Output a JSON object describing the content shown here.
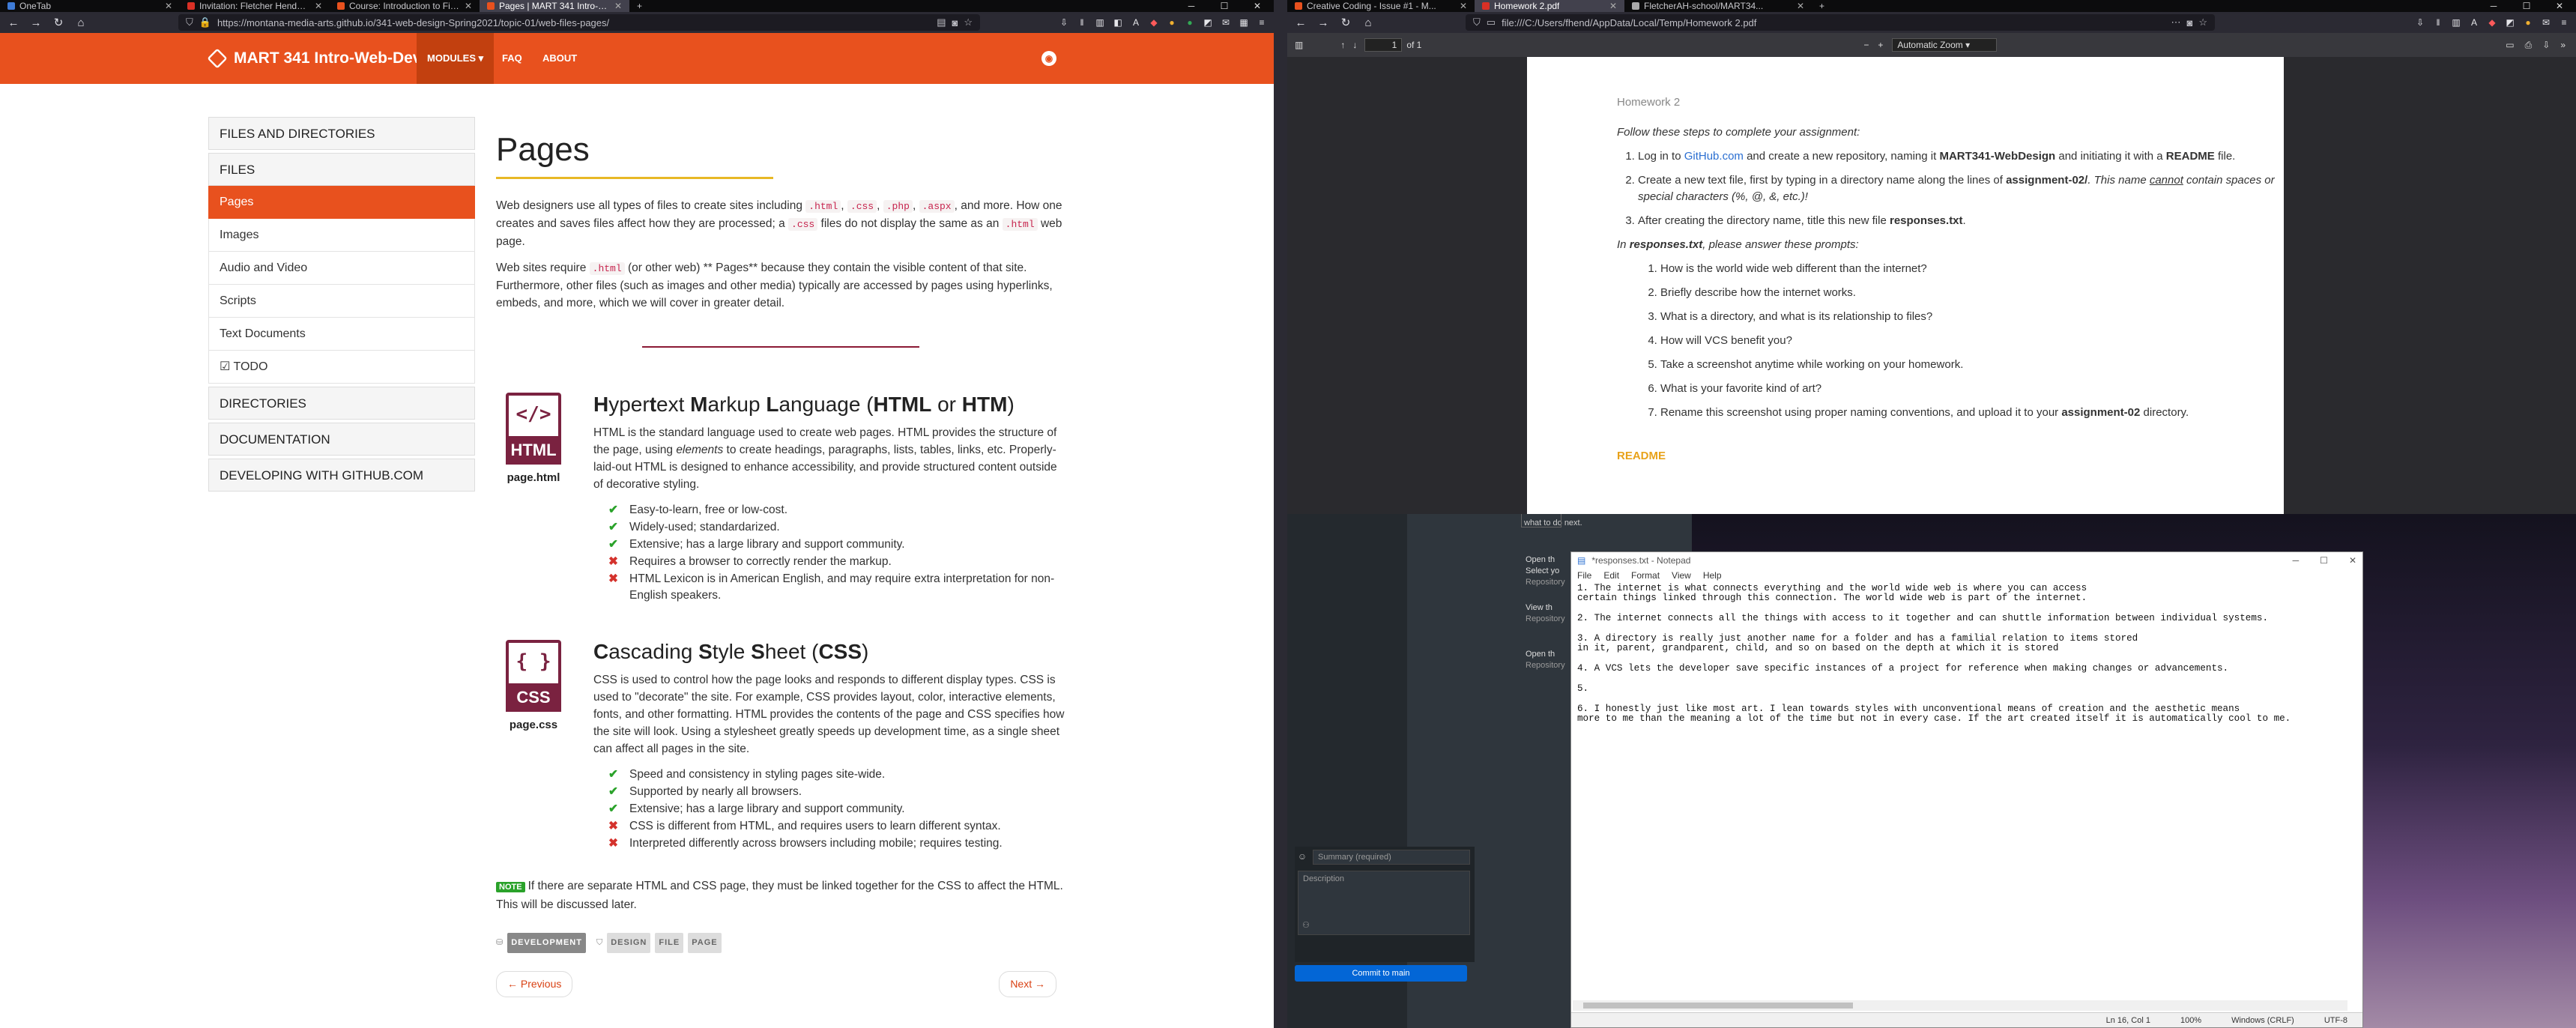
{
  "left_browser": {
    "tabs": [
      {
        "label": "OneTab",
        "color": "#3e7bd6"
      },
      {
        "label": "Invitation: Fletcher Henderson @ ...",
        "color": "#d93025"
      },
      {
        "label": "Course: Introduction to Film D...",
        "color": "#e8511e"
      },
      {
        "label": "Pages | MART 341 Intro-Web-D...",
        "color": "#e8511e",
        "active": true
      }
    ],
    "new_tab": "+",
    "url": "https://montana-media-arts.github.io/341-web-design-Spring2021/topic-01/web-files-pages/",
    "site": {
      "brand": "MART 341 Intro-Web-Dev",
      "nav": [
        "MODULES ▾",
        "FAQ",
        "ABOUT"
      ]
    },
    "sidebar": {
      "groups": [
        {
          "label": "FILES AND DIRECTORIES"
        },
        {
          "label": "FILES",
          "items": [
            "Pages",
            "Images",
            "Audio and Video",
            "Scripts",
            "Text Documents",
            "TODO"
          ]
        },
        {
          "label": "DIRECTORIES"
        },
        {
          "label": "DOCUMENTATION"
        },
        {
          "label": "DEVELOPING WITH GITHUB.COM"
        }
      ]
    },
    "content": {
      "title": "Pages",
      "p1_a": "Web designers use all types of files to create sites including ",
      "codes1": [
        ".html",
        ".css",
        ".php",
        ".aspx"
      ],
      "p1_b": ", and more. How one creates and saves files affect how they are processed; a ",
      "code_css": ".css",
      "p1_c": " files do not display the same as an ",
      "code_html": ".html",
      "p1_d": " web page.",
      "p2_a": "Web sites require ",
      "p2_b": " (or other web) ** Pages** because they contain the visible content of that site. Furthermore, other files (such as images and other media) typically are accessed by pages using hyperlinks, embeds, and more, which we will cover in greater detail.",
      "html": {
        "icon_symbol": "</>",
        "icon_label": "HTML",
        "file": "page.html",
        "heading_parts": [
          "H",
          "yper",
          "t",
          "ext ",
          "M",
          "arkup ",
          "L",
          "anguage (",
          "HTML",
          " or ",
          "HTM",
          ")"
        ],
        "desc_a": "HTML is the standard language used to create web pages. HTML provides the structure of the page, using ",
        "desc_em": "elements",
        "desc_b": " to create headings, paragraphs, lists, tables, links, etc. Properly-laid-out HTML is designed to enhance accessibility, and provide structured content outside of decorative styling.",
        "items": [
          {
            "kind": "pro",
            "mark": "✔",
            "text": "Easy-to-learn, free or low-cost."
          },
          {
            "kind": "pro",
            "mark": "✔",
            "text": "Widely-used; standardarized."
          },
          {
            "kind": "pro",
            "mark": "✔",
            "text": "Extensive; has a large library and support community."
          },
          {
            "kind": "con",
            "mark": "✖",
            "text": "Requires a browser to correctly render the markup."
          },
          {
            "kind": "con",
            "mark": "✖",
            "text": "HTML Lexicon is in American English, and may require extra interpretation for non-English speakers."
          }
        ]
      },
      "css": {
        "icon_symbol": "{ }",
        "icon_label": "CSS",
        "file": "page.css",
        "heading_parts": [
          "C",
          "ascading ",
          "S",
          "tyle ",
          "S",
          "heet (",
          "CSS",
          ")"
        ],
        "desc_a": "CSS is used to control how the page looks and responds to different display types. CSS is used to \"decorate\" the site. For example, CSS provides layout, color, interactive elements, fonts, and other formatting. HTML provides the contents of the page and CSS specifies how the site will look. Using a stylesheet greatly speeds up development time, as a single sheet can affect all pages in the site.",
        "items": [
          {
            "kind": "pro",
            "mark": "✔",
            "text": "Speed and consistency in styling pages site-wide."
          },
          {
            "kind": "pro",
            "mark": "✔",
            "text": "Supported by nearly all browsers."
          },
          {
            "kind": "pro",
            "mark": "✔",
            "text": "Extensive; has a large library and support community."
          },
          {
            "kind": "con",
            "mark": "✖",
            "text": "CSS is different from HTML, and requires users to learn different syntax."
          },
          {
            "kind": "con",
            "mark": "✖",
            "text": "Interpreted differently across browsers including mobile; requires testing."
          }
        ]
      },
      "note_badge": "NOTE",
      "note_text": "If there are separate HTML and CSS page, they must be linked together for the CSS to affect the HTML. This will be discussed later.",
      "category": "DEVELOPMENT",
      "tags": [
        "DESIGN",
        "FILE",
        "PAGE"
      ],
      "prev": "← Previous",
      "next": "Next →"
    }
  },
  "right_browser": {
    "tabs": [
      {
        "label": "Creative Coding - Issue #1 - M...",
        "color": "#e8511e"
      },
      {
        "label": "Homework 2.pdf",
        "color": "#d93025",
        "active": true
      },
      {
        "label": "FletcherAH-school/MART34...",
        "color": "#aaaaaa"
      }
    ],
    "new_tab": "+",
    "url": "file:///C:/Users/fhend/AppData/Local/Temp/Homework 2.pdf",
    "pdf_toolbar": {
      "page": "1",
      "of": "of 1",
      "zoom": "Automatic Zoom"
    },
    "pdf": {
      "heading": "Homework 2",
      "intro": "Follow these steps to complete your assignment:",
      "step1_a": "Log in to ",
      "step1_link": "GitHub.com",
      "step1_b": " and create a new repository, naming it ",
      "step1_bold": "MART341-WebDesign",
      "step1_c": " and initiating it with a ",
      "step1_bold2": "README",
      "step1_d": " file.",
      "step2_a": "Create a new text file, first by typing in a directory name along the lines of ",
      "step2_bold": "assignment-02/",
      "step2_b": ". This name ",
      "step2_u": "cannot",
      "step2_c": " contain spaces or special characters (%, @, &, etc.)!",
      "step3_a": "After creating the directory name, title this new file ",
      "step3_bold": "responses.txt",
      "step3_b": ".",
      "prompt_a": "In ",
      "prompt_bold": "responses.txt",
      "prompt_b": ", please answer these prompts:",
      "questions": [
        "How is the world wide web different than the internet?",
        "Briefly describe how the internet works.",
        "What is a directory, and what is its relationship to files?",
        "How will VCS benefit you?",
        "Take a screenshot anytime while working on your homework.",
        "What is your favorite kind of art?"
      ],
      "q7_a": "Rename this screenshot using proper naming conventions, and upload it to your ",
      "q7_bold": "assignment-02",
      "q7_b": " directory.",
      "readme": "README"
    }
  },
  "github_desktop": {
    "hint": "what to do next.",
    "open1": "Open th",
    "select": "Select yo",
    "repo1": "Repository",
    "view": "View th",
    "repo2": "Repository",
    "open2": "Open th",
    "repo3": "Repository",
    "summary_placeholder": "Summary (required)",
    "description_placeholder": "Description",
    "commit_button": "Commit to main"
  },
  "notepad": {
    "title": "*responses.txt - Notepad",
    "menu": [
      "File",
      "Edit",
      "Format",
      "View",
      "Help"
    ],
    "lines": [
      "1. The internet is what connects everything and the world wide web is where you can access",
      "certain things linked through this connection. The world wide web is part of the internet.",
      "",
      "2. The internet connects all the things with access to it together and can shuttle information between individual systems.",
      "",
      "3. A directory is really just another name for a folder and has a familial relation to items stored",
      "in it, parent, grandparent, child, and so on based on the depth at which it is stored",
      "",
      "4. A VCS lets the developer save specific instances of a project for reference when making changes or advancements.",
      "",
      "5.",
      "",
      "6. I honestly just like most art. I lean towards styles with unconventional means of creation and the aesthetic means",
      "more to me than the meaning a lot of the time but not in every case. If the art created itself it is automatically cool to me."
    ],
    "status": [
      "Ln 16, Col 1",
      "100%",
      "Windows (CRLF)",
      "UTF-8"
    ]
  }
}
